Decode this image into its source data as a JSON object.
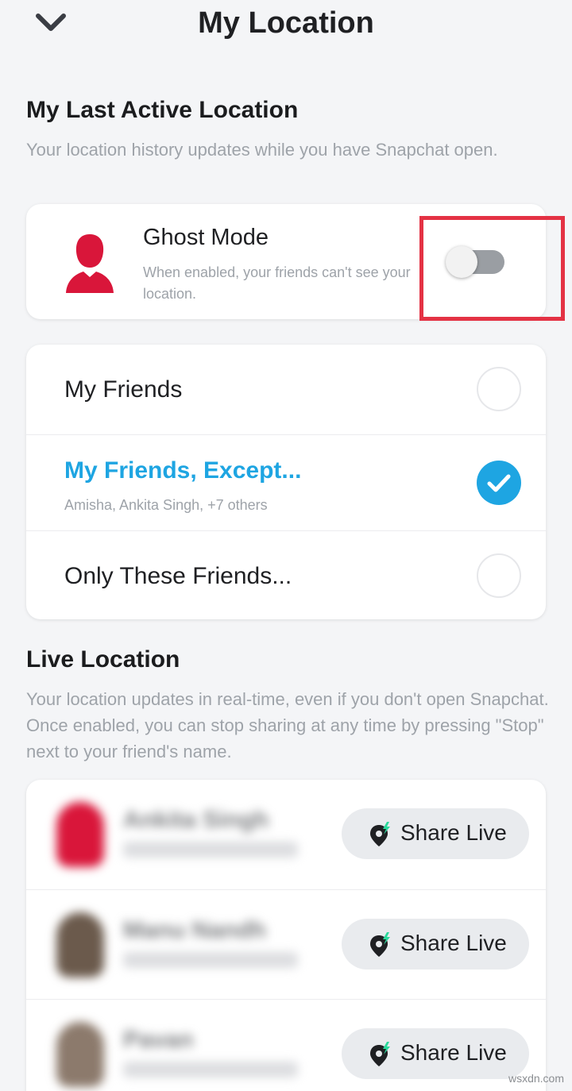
{
  "header": {
    "title": "My Location",
    "back_icon": "chevron-down-icon"
  },
  "last_active": {
    "title": "My Last Active Location",
    "description": "Your location history updates while you have Snapchat open."
  },
  "ghost_mode": {
    "title": "Ghost Mode",
    "description": "When enabled, your friends can't see your location.",
    "enabled": false,
    "highlight_color": "#e43244",
    "avatar_color": "#d9163a"
  },
  "sharing_options": [
    {
      "label": "My Friends",
      "sublabel": "",
      "selected": false
    },
    {
      "label": "My Friends, Except...",
      "sublabel": "Amisha, Ankita Singh, +7 others",
      "selected": true
    },
    {
      "label": "Only These Friends...",
      "sublabel": "",
      "selected": false
    }
  ],
  "live_location": {
    "title": "Live Location",
    "description": "Your location updates in real-time, even if you don't open Snapchat. Once enabled, you can stop sharing at any time by pressing \"Stop\" next to your friend's name.",
    "friends": [
      {
        "name": "Ankita Singh",
        "button": "Share Live",
        "avatar_color": "#d9163a"
      },
      {
        "name": "Manu Nandh",
        "button": "Share Live",
        "avatar_color": "#6b5a4c"
      },
      {
        "name": "Pavan",
        "button": "Share Live",
        "avatar_color": "#8c7a6c"
      }
    ]
  },
  "colors": {
    "accent": "#1ea5e2",
    "background": "#f4f5f7"
  },
  "watermark": "wsxdn.com"
}
